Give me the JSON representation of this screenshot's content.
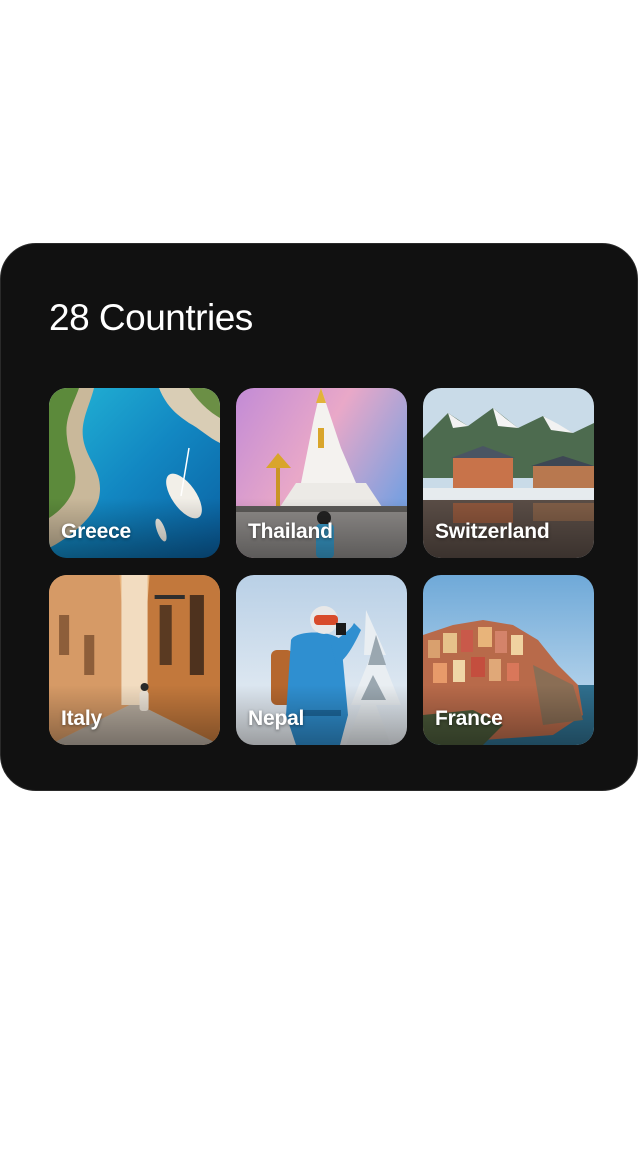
{
  "header": {
    "title": "28 Countries"
  },
  "countries": [
    {
      "name": "Greece"
    },
    {
      "name": "Thailand"
    },
    {
      "name": "Switzerland"
    },
    {
      "name": "Italy"
    },
    {
      "name": "Nepal"
    },
    {
      "name": "France"
    }
  ],
  "colors": {
    "card_background": "#111111",
    "title_text": "#ffffff",
    "label_text": "#ffffff"
  }
}
